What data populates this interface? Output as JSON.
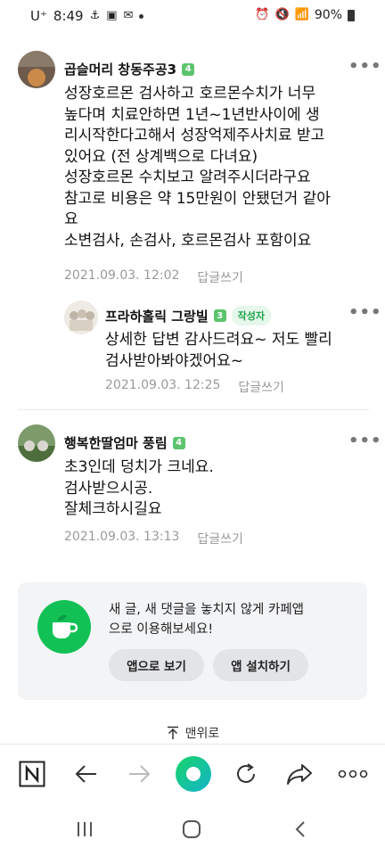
{
  "status_bar": {
    "carrier": "U⁺",
    "time": "8:49",
    "battery": "90%"
  },
  "comments": [
    {
      "nickname": "곱슬머리 창동주공3",
      "level": "4",
      "text": "성장호르몬 검사하고 호르몬수치가 너무\n높다며 치료안하면 1년~1년반사이에 생\n리시작한다고해서 성장억제주사치료 받고\n있어요 (전 상계백으로 다녀요)\n성장호르몬 수치보고 알려주시더라구요\n참고로 비용은 약 15만원이 안됐던거 같아\n요\n소변검사, 손검사, 호르몬검사 포함이요",
      "date": "2021.09.03. 12:02",
      "reply_label": "답글쓰기"
    },
    {
      "nickname": "프라하홀릭 그랑빌",
      "level": "3",
      "badge": "작성자",
      "text": "상세한 답변 감사드려요~ 저도 빨리\n검사받아봐야겠어요~",
      "date": "2021.09.03. 12:25",
      "reply_label": "답글쓰기"
    },
    {
      "nickname": "행복한딸엄마 풍림",
      "level": "4",
      "text": "초3인데 덩치가 크네요.\n검사받으시공.\n잘체크하시길요",
      "date": "2021.09.03. 13:13",
      "reply_label": "답글쓰기"
    }
  ],
  "promo": {
    "text": "새 글, 새 댓글을 놓치지 않게 카페앱\n으로 이용해보세요!",
    "open_app": "앱으로 보기",
    "install_app": "앱 설치하기"
  },
  "to_top": "맨위로",
  "colors": {
    "accent_green": "#12c155",
    "level_green": "#5cc46e",
    "meta_gray": "#9a9a9a"
  }
}
